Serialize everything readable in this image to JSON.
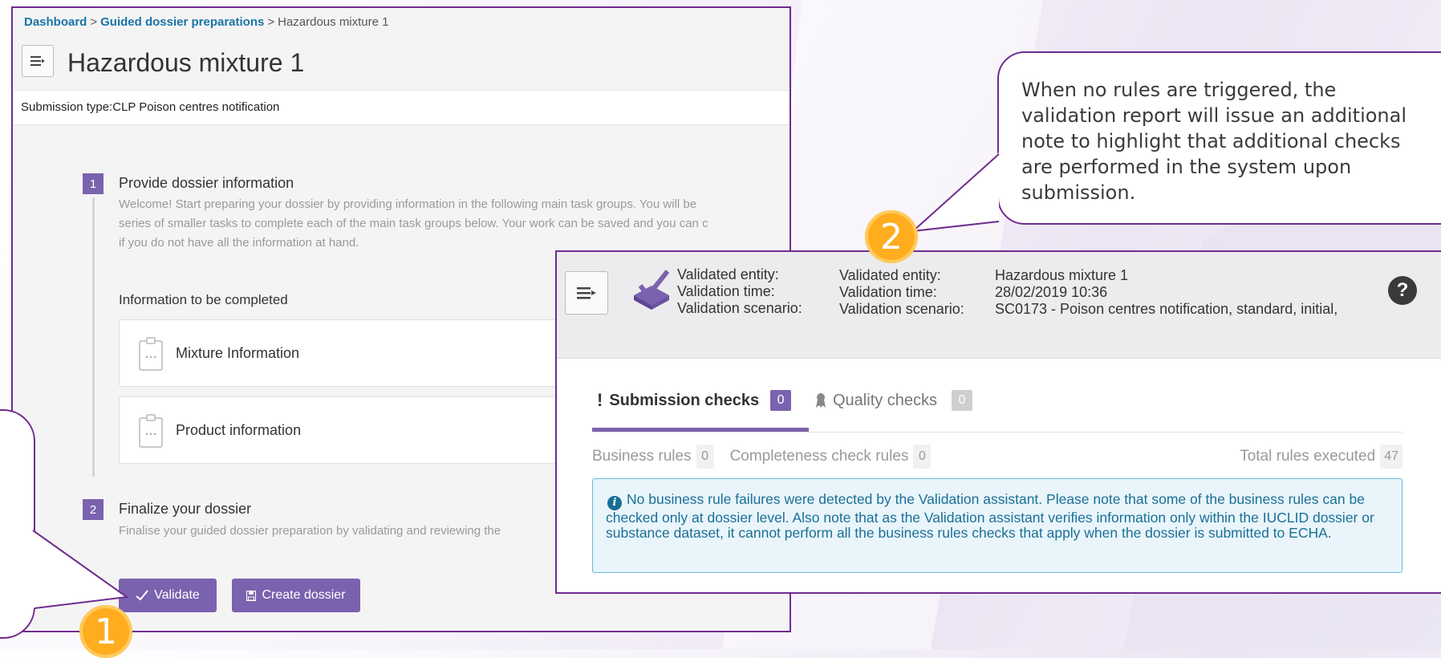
{
  "breadcrumb": {
    "items": [
      "Dashboard",
      "Guided dossier preparations",
      "Hazardous mixture 1"
    ],
    "separator": ">"
  },
  "page": {
    "title": "Hazardous mixture 1",
    "submission_type": "Submission type:CLP Poison centres notification"
  },
  "steps": [
    {
      "number": "1",
      "title": "Provide dossier information",
      "description": "Welcome! Start preparing your dossier by providing information in the following main task groups. You will be",
      "description_line2": "series of smaller tasks to complete each of the main task groups below. Your work can be saved and you can c",
      "description_line3": "if you do not have all the information at hand."
    },
    {
      "number": "2",
      "title": "Finalize your dossier",
      "description": "Finalise your guided dossier preparation by validating and reviewing the"
    }
  ],
  "info_section_label": "Information to be completed",
  "tasks": [
    {
      "label": "Mixture Information",
      "icon": "clipboard-icon"
    },
    {
      "label": "Product information",
      "icon": "clipboard-icon"
    }
  ],
  "buttons": {
    "validate": "Validate",
    "validate_icon": "hand-check-icon",
    "create": "Create dossier",
    "create_icon": "save-icon"
  },
  "callout": {
    "text": "When no rules are triggered, the\nvalidation report will issue an additional\nnote to highlight that additional checks\nare performed in the system upon\nsubmission."
  },
  "markers": [
    "1",
    "2"
  ],
  "validation": {
    "labels_bold": [
      "Validated entity:",
      "Validation time:",
      "Validation scenario:"
    ],
    "labels": [
      "Validated entity:",
      "Validation time:",
      "Validation scenario:"
    ],
    "values": [
      "Hazardous mixture 1",
      "28/02/2019 10:36",
      "SC0173 - Poison centres notification, standard, initial,"
    ],
    "help": "?",
    "tabs": [
      {
        "label": "Submission checks",
        "count": "0",
        "icon": "exclamation-icon"
      },
      {
        "label": "Quality checks",
        "count": "0",
        "icon": "ribbon-icon"
      }
    ],
    "business_rules": {
      "label": "Business rules",
      "count": "0"
    },
    "completeness_rules": {
      "label": "Completeness check rules",
      "count": "0"
    },
    "total_rules": {
      "label": "Total rules executed",
      "count": "47"
    },
    "info": "No business rule failures were detected by the Validation assistant. Please note that some of the business rules can be checked only at dossier level. Also note that as the Validation assistant verifies information only within the IUCLID dossier or substance dataset, it cannot perform all the business rules checks that apply when the dossier is submitted to ECHA."
  },
  "colors": {
    "accent": "#7b62ae",
    "frame": "#6f2c8f",
    "link": "#1a74a7",
    "marker": "#ffad1f",
    "info_text": "#1a6f96",
    "info_bg": "#e9f5fb"
  }
}
